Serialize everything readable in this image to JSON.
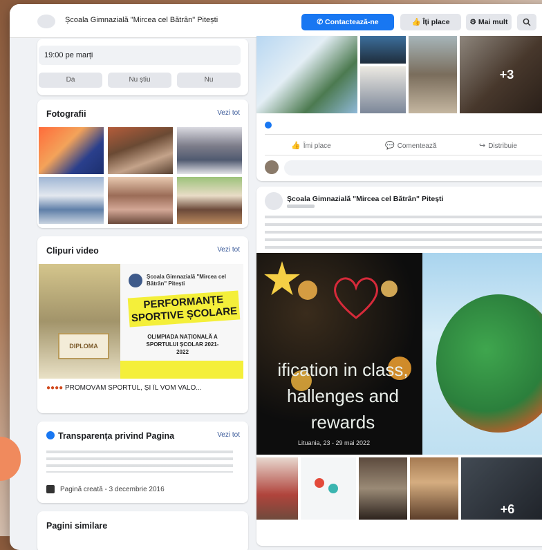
{
  "header": {
    "page_name": "Școala Gimnazială \"Mircea cel Bătrân\" Pitești",
    "contact_label": "✆ Contactează-ne",
    "like_label": "👍 Îți place",
    "more_label": "⚙ Mai mult",
    "search_icon": "search-icon"
  },
  "hours_card": {
    "text": "19:00 pe marți",
    "options": [
      "Da",
      "Nu știu",
      "Nu"
    ]
  },
  "photos_card": {
    "title": "Fotografii",
    "see_all": "Vezi tot"
  },
  "videos_card": {
    "title": "Clipuri video",
    "see_all": "Vezi tot",
    "video_school": "Școala Gimnazială \"Mircea cel Bătrân\" Pitești",
    "video_headline": "PERFORMANȚE SPORTIVE ȘCOLARE",
    "video_sub": "OLIMPIADA NAȚIONALĂ A SPORTULUI ȘCOLAR 2021-2022",
    "video_caption": "PROMOVĂM SPORTUL, ȘI ÎL VOM VALO...",
    "diploma_text": "DIPLOMA"
  },
  "transparency_card": {
    "title": "Transparența privind Pagina",
    "see_all": "Vezi tot",
    "created": "Pagină creată - 3 decembrie 2016"
  },
  "similar_card": {
    "title": "Pagini similare"
  },
  "post1": {
    "more_photos": "+3",
    "like_action": "Îmi place",
    "comment_action": "Comentează",
    "share_action": "Distribuie"
  },
  "post2": {
    "author": "Școala Gimnazială \"Mircea cel Bătrân\" Pitești",
    "image_text": [
      "ification in class,",
      "hallenges and",
      "rewards"
    ],
    "image_date": "Lituania, 23 - 29 mai 2022",
    "more_photos": "+6"
  },
  "colors": {
    "brand": "#1877f2",
    "page_bg": "#f0f2f5"
  }
}
